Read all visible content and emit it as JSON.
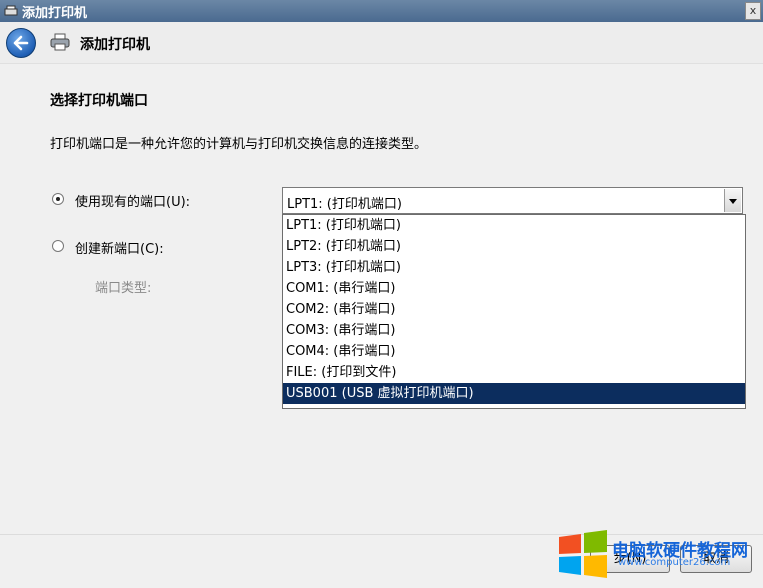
{
  "window": {
    "title": "添加打印机",
    "close_glyph": "x"
  },
  "header": {
    "title": "添加打印机"
  },
  "page": {
    "section_title": "选择打印机端口",
    "description": "打印机端口是一种允许您的计算机与打印机交换信息的连接类型。",
    "option_existing": {
      "label": "使用现有的端口(U):",
      "selected": true
    },
    "option_new": {
      "label": "创建新端口(C):",
      "selected": false
    },
    "port_type_label": "端口类型:"
  },
  "port_combo": {
    "value": "LPT1: (打印机端口)",
    "options": [
      "LPT1: (打印机端口)",
      "LPT2: (打印机端口)",
      "LPT3: (打印机端口)",
      "COM1: (串行端口)",
      "COM2: (串行端口)",
      "COM3: (串行端口)",
      "COM4: (串行端口)",
      "FILE: (打印到文件)",
      "USB001 (USB 虚拟打印机端口)"
    ],
    "highlighted_index": 8
  },
  "footer": {
    "next_label": "步(N)",
    "cancel_label": "取消"
  },
  "watermark": {
    "text": "电脑软硬件教程网",
    "url": "www.computer26.com"
  },
  "colors": {
    "selection": "#0c2d5e",
    "titlebar": "#5a7aa0",
    "watermark": "#1565d8"
  }
}
